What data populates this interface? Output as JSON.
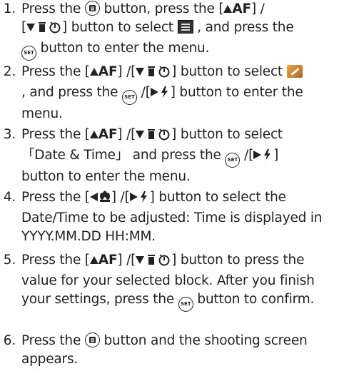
{
  "steps": [
    {
      "number": "1",
      "parts": {
        "a": "Press the ",
        "b": " button, press the [",
        "c": "AF",
        "d": "] /",
        "e": "[",
        "f": "] button to select ",
        "g": " , and press the ",
        "h": "SET",
        "i": " button to enter the menu."
      }
    },
    {
      "number": "2",
      "parts": {
        "a": "Press the [",
        "b": "AF",
        "c": "] /[",
        "d": "] button to select ",
        "e": ", and press the ",
        "f": "SET",
        "g": " /[",
        "h": "] button to enter the menu."
      }
    },
    {
      "number": "3",
      "parts": {
        "a": "Press the [",
        "b": "AF",
        "c": "] /[",
        "d": "] button to select",
        "e": "「Date & Time」 and press the ",
        "f": "SET",
        "g": " /[",
        "h": "]",
        "i": "button to enter the menu."
      }
    },
    {
      "number": "4",
      "parts": {
        "a": "Press the [",
        "b": "] /[",
        "c": "] button to select the Date/Time to be adjusted: Time is displayed in YYYY.MM.DD HH:MM."
      }
    },
    {
      "number": "5",
      "parts": {
        "a": "Press the [",
        "b": "AF",
        "c": "] /[",
        "d": "] button to press the value for your selected block. After you finish your settings, press the ",
        "e": "SET",
        "f": " button to confirm."
      }
    },
    {
      "number": "6",
      "parts": {
        "a": "Press the ",
        "b": " button and the shooting screen appears."
      }
    }
  ],
  "icons": {
    "menu_button": "menu-button-icon",
    "set_button": "set-button-icon",
    "up_af": "up-af-icon",
    "down_delete_timer": "down-delete-selftimer-icon",
    "right_flash": "right-flash-icon",
    "left_macro": "left-macro-icon",
    "menu_tab": "menu-tab-icon",
    "setup_wrench": "setup-wrench-icon"
  }
}
